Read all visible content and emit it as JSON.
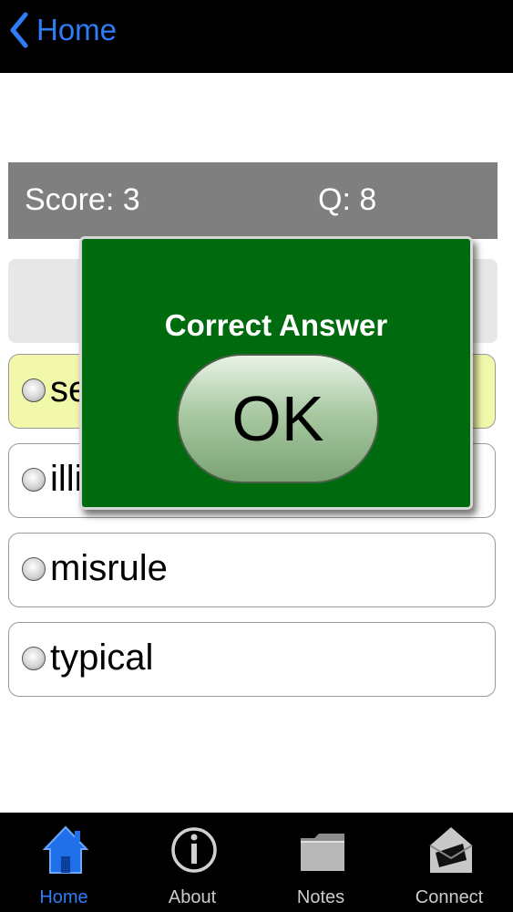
{
  "nav": {
    "back_label": "Home",
    "back_icon": "chevron-left-icon"
  },
  "quiz": {
    "score_text": "Score: 3",
    "question_text": "Q: 8",
    "question": "",
    "options": [
      {
        "label": "se",
        "selected": true
      },
      {
        "label": "illi",
        "selected": false
      },
      {
        "label": "misrule",
        "selected": false
      },
      {
        "label": "typical",
        "selected": false
      }
    ]
  },
  "dialog": {
    "title": "Correct Answer",
    "ok_label": "OK"
  },
  "tabbar": {
    "tabs": [
      {
        "label": "Home",
        "icon": "home-icon",
        "active": true
      },
      {
        "label": "About",
        "icon": "info-icon",
        "active": false
      },
      {
        "label": "Notes",
        "icon": "folder-icon",
        "active": false
      },
      {
        "label": "Connect",
        "icon": "envelope-icon",
        "active": false
      }
    ]
  },
  "colors": {
    "accent": "#2f7cf6",
    "dialog_background": "#006b0e",
    "selected_option": "#f2f8aa",
    "score_bar": "#7f7f7f",
    "tab_inactive": "#cccccc"
  }
}
